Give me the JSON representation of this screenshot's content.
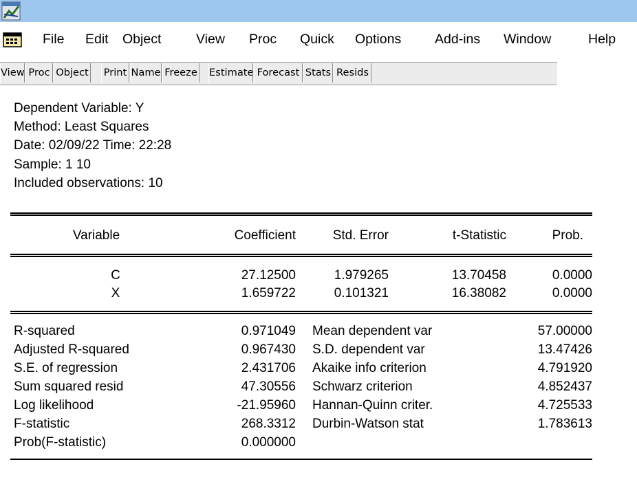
{
  "menu": {
    "items": [
      "File",
      "Edit",
      "Object",
      "View",
      "Proc",
      "Quick",
      "Options",
      "Add-ins",
      "Window",
      "Help"
    ]
  },
  "toolbar": {
    "buttons": [
      "View",
      "Proc",
      "Object",
      "Print",
      "Name",
      "Freeze",
      "Estimate",
      "Forecast",
      "Stats",
      "Resids"
    ]
  },
  "output": {
    "header": [
      "Dependent Variable: Y",
      "Method: Least Squares",
      "Date: 02/09/22   Time: 22:28",
      "Sample: 1 10",
      "Included observations: 10"
    ],
    "coef_headers": [
      "Variable",
      "Coefficient",
      "Std. Error",
      "t-Statistic",
      "Prob."
    ],
    "coef_rows": [
      [
        "C",
        "27.12500",
        "1.979265",
        "13.70458",
        "0.0000"
      ],
      [
        "X",
        "1.659722",
        "0.101321",
        "16.38082",
        "0.0000"
      ]
    ],
    "stats_rows": [
      [
        "R-squared",
        "0.971049",
        "Mean dependent var",
        "57.00000"
      ],
      [
        "Adjusted R-squared",
        "0.967430",
        "S.D. dependent var",
        "13.47426"
      ],
      [
        "S.E. of regression",
        "2.431706",
        "Akaike info criterion",
        "4.791920"
      ],
      [
        "Sum squared resid",
        "47.30556",
        "Schwarz criterion",
        "4.852437"
      ],
      [
        "Log likelihood",
        "-21.95960",
        "Hannan-Quinn criter.",
        "4.725533"
      ],
      [
        "F-statistic",
        "268.3312",
        "Durbin-Watson stat",
        "1.783613"
      ],
      [
        "Prob(F-statistic)",
        "0.000000",
        "",
        ""
      ]
    ]
  }
}
